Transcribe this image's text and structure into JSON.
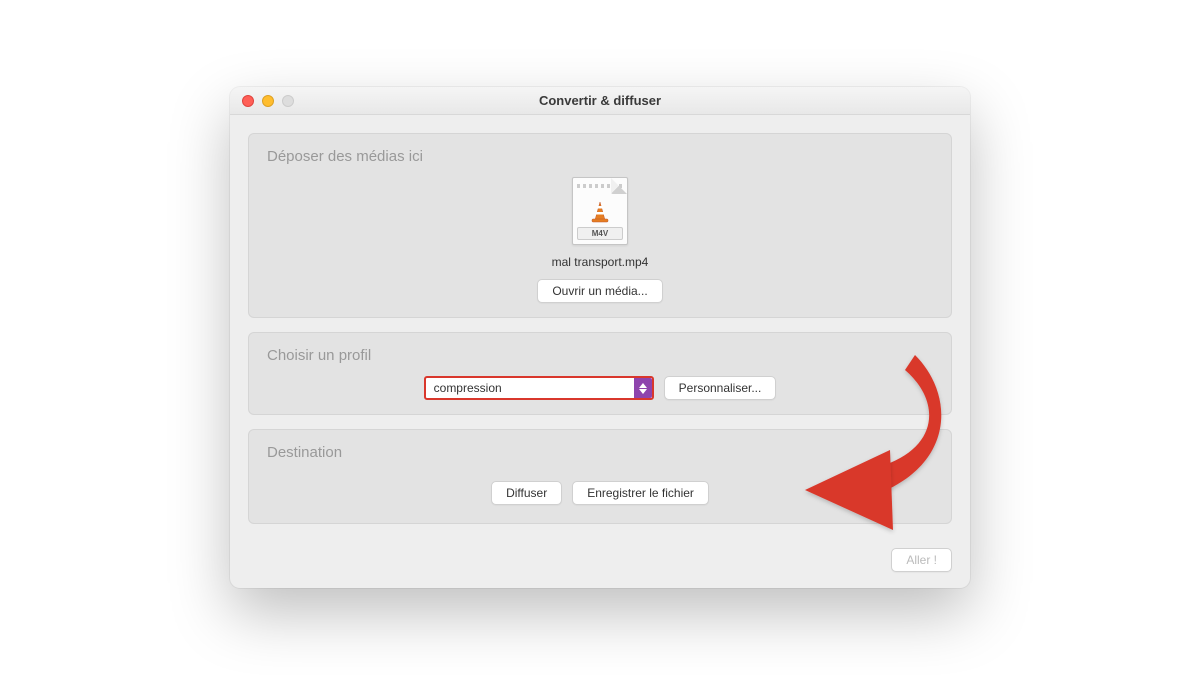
{
  "window": {
    "title": "Convertir & diffuser"
  },
  "mediaSection": {
    "title": "Déposer des médias ici",
    "format": "M4V",
    "fileName": "mal transport.mp4",
    "openButton": "Ouvrir un média..."
  },
  "profileSection": {
    "title": "Choisir un profil",
    "selected": "compression",
    "customizeButton": "Personnaliser..."
  },
  "destinationSection": {
    "title": "Destination",
    "streamButton": "Diffuser",
    "saveButton": "Enregistrer le fichier"
  },
  "footer": {
    "goButton": "Aller !"
  },
  "colors": {
    "highlight": "#D9372C",
    "arrow": "#D9372C"
  }
}
